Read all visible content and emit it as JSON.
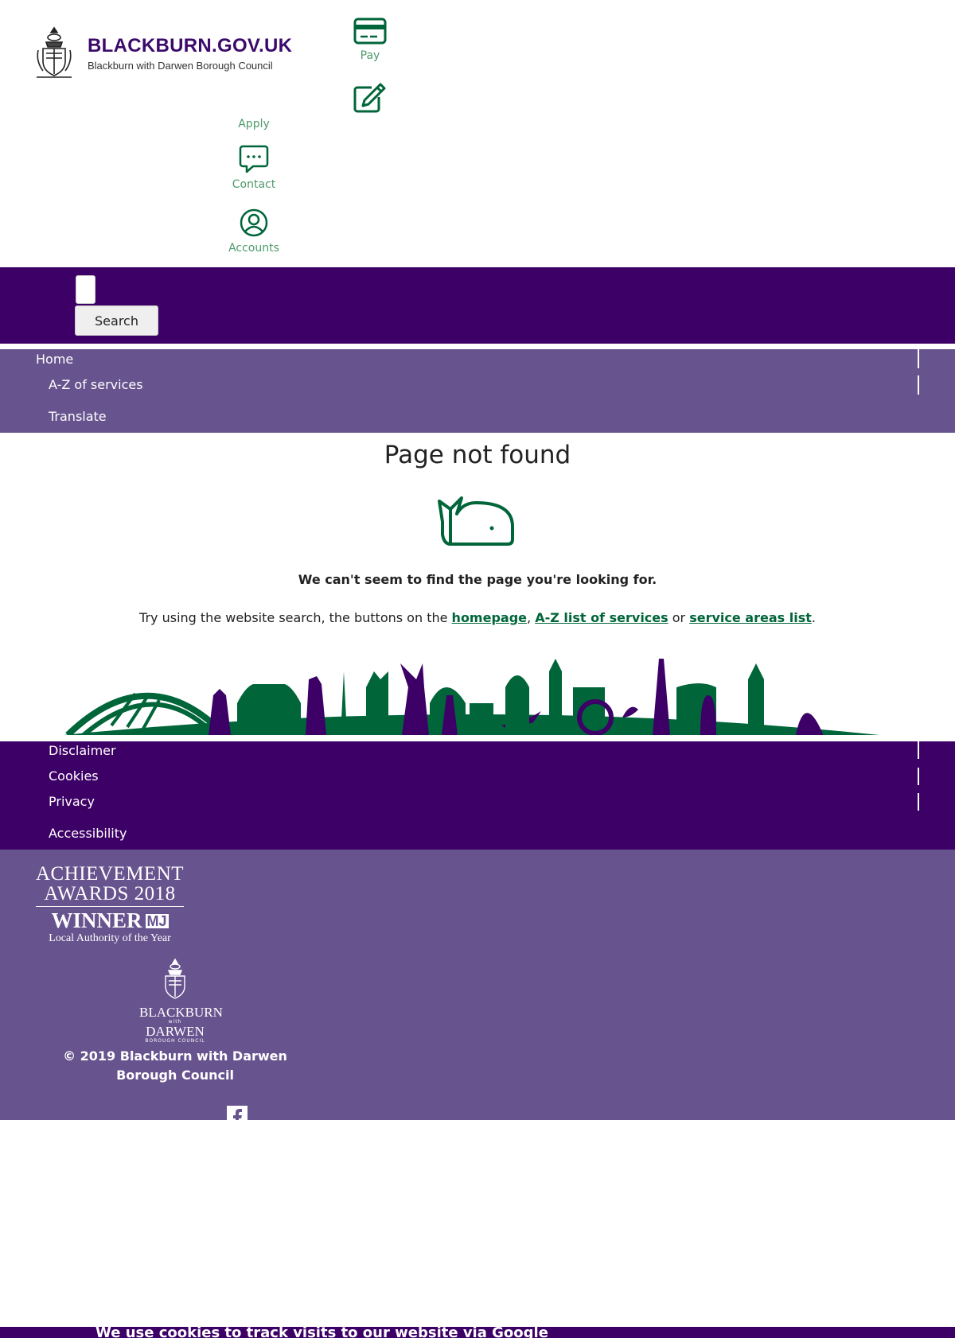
{
  "header": {
    "site_name": "BLACKBURN.GOV.UK",
    "site_subtitle": "Blackburn with Darwen Borough Council",
    "quick_links": {
      "pay": "Pay",
      "apply": "Apply",
      "contact": "Contact",
      "accounts": "Accounts"
    }
  },
  "search": {
    "button_label": "Search",
    "input_value": ""
  },
  "nav": {
    "home": "Home",
    "az": "A-Z of services",
    "translate": "Translate"
  },
  "main": {
    "title": "Page not found",
    "lead": "We can't seem to find the page you're looking for.",
    "help_prefix": "Try using the website search, the buttons on the ",
    "link_homepage": "homepage",
    "sep1": ", ",
    "link_az": "A-Z list of services",
    "sep2": " or ",
    "link_areas": "service areas list",
    "suffix": "."
  },
  "footer_nav": {
    "disclaimer": "Disclaimer",
    "cookies": "Cookies",
    "privacy": "Privacy",
    "accessibility": "Accessibility"
  },
  "award": {
    "line1": "ACHIEVEMENT",
    "line2": "AWARDS 2018",
    "line3": "WINNER",
    "badge": "MJ",
    "line4": "Local Authority of the Year"
  },
  "council_logo": {
    "line1": "BLACKBURN",
    "line2": "with",
    "line3": "DARWEN",
    "line4": "BOROUGH COUNCIL"
  },
  "footer": {
    "copyright": "© 2019 Blackburn with Darwen Borough Council"
  },
  "cookie_banner": {
    "text": "We use cookies to track visits to our website via Google"
  },
  "colors": {
    "primary_purple": "#3d0066",
    "light_purple": "#67538e",
    "accent_green": "#00663a"
  }
}
